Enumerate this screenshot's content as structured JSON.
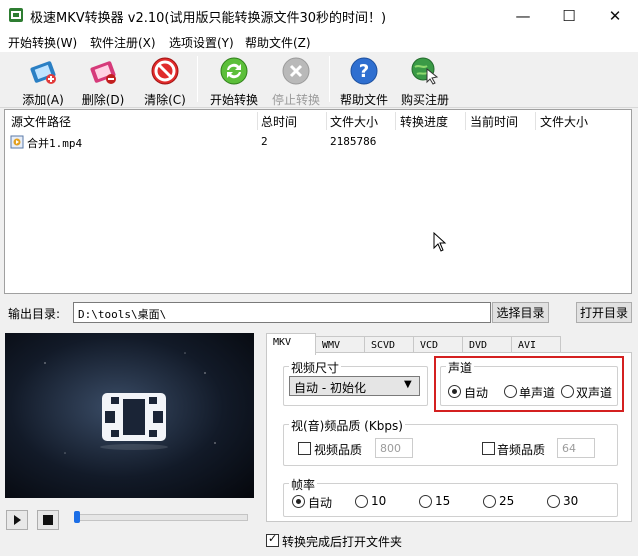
{
  "window": {
    "title": "极速MKV转换器 v2.10(试用版只能转换源文件30秒的时间！)",
    "controls": {
      "minimize": "—",
      "maximize": "☐",
      "close": "✕"
    }
  },
  "menu": [
    "开始转换(W)",
    "软件注册(X)",
    "选项设置(Y)",
    "帮助文件(Z)"
  ],
  "toolbar": {
    "add": "添加(A)",
    "delete": "删除(D)",
    "clear": "清除(C)",
    "start": "开始转换",
    "stop": "停止转换",
    "help": "帮助文件",
    "buy": "购买注册"
  },
  "filelist": {
    "columns": [
      "源文件路径",
      "总时间",
      "文件大小",
      "转换进度",
      "当前时间",
      "文件大小"
    ],
    "rows": [
      {
        "path": "合并1.mp4",
        "total_time": "2",
        "size": "2185786",
        "progress": "",
        "current": "",
        "out_size": ""
      }
    ]
  },
  "output": {
    "label": "输出目录:",
    "path": "D:\\tools\\桌面\\",
    "choose_btn": "选择目录",
    "open_btn": "打开目录"
  },
  "player": {
    "seek_position": 0.0
  },
  "tabs": [
    "MKV",
    "WMV",
    "SCVD",
    "VCD",
    "DVD",
    "AVI"
  ],
  "active_tab": "MKV",
  "settings": {
    "video_size": {
      "label": "视频尺寸",
      "value": "自动 - 初始化"
    },
    "channel": {
      "label": "声道",
      "options": [
        "自动",
        "单声道",
        "双声道"
      ],
      "selected": "自动"
    },
    "quality": {
      "label": "视(音)频品质 (Kbps)",
      "video_label": "视频品质",
      "video_value": "800",
      "video_checked": false,
      "audio_label": "音频品质",
      "audio_value": "64",
      "audio_checked": false
    },
    "framerate": {
      "label": "帧率",
      "options": [
        "自动",
        "10",
        "15",
        "25",
        "30"
      ],
      "selected": "自动"
    }
  },
  "open_after": {
    "label": "转换完成后打开文件夹",
    "checked": true
  },
  "colors": {
    "highlight": "#d42020",
    "seek_accent": "#1c6ee6"
  }
}
